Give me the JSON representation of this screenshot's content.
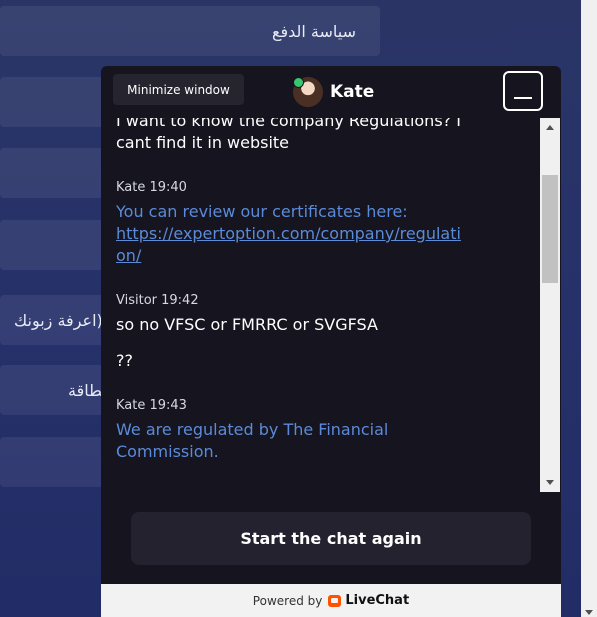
{
  "background": {
    "items": [
      {
        "label": "سياسة الدفع"
      },
      {
        "label": ""
      },
      {
        "label": ""
      },
      {
        "label": ""
      },
      {
        "label": "اعرفة زبونك)"
      },
      {
        "label": "بطاقة"
      },
      {
        "label": ""
      }
    ]
  },
  "chat": {
    "agent_name": "Kate",
    "tooltip": "Minimize window",
    "messages": {
      "m1_text": "I want to know the company Regulations? I cant find it in website",
      "m2_meta": "Kate 19:40",
      "m2_text": "You can review our certificates here:",
      "m2_link": "https://expertoption.com/company/regulation/",
      "m3_meta": "Visitor 19:42",
      "m3_text1": "so no VFSC or FMRRC or SVGFSA",
      "m3_text2": "??",
      "m4_meta": "Kate 19:43",
      "m4_text": "We are regulated by The Financial Commission."
    },
    "restart_label": "Start the chat again",
    "powered_by": "Powered by",
    "brand": "LiveChat"
  },
  "colors": {
    "page_bg": "#26316a",
    "chat_bg": "#15141f",
    "agent_text": "#5b8bd8",
    "online": "#37c76f",
    "livechat_orange": "#ff5100"
  }
}
